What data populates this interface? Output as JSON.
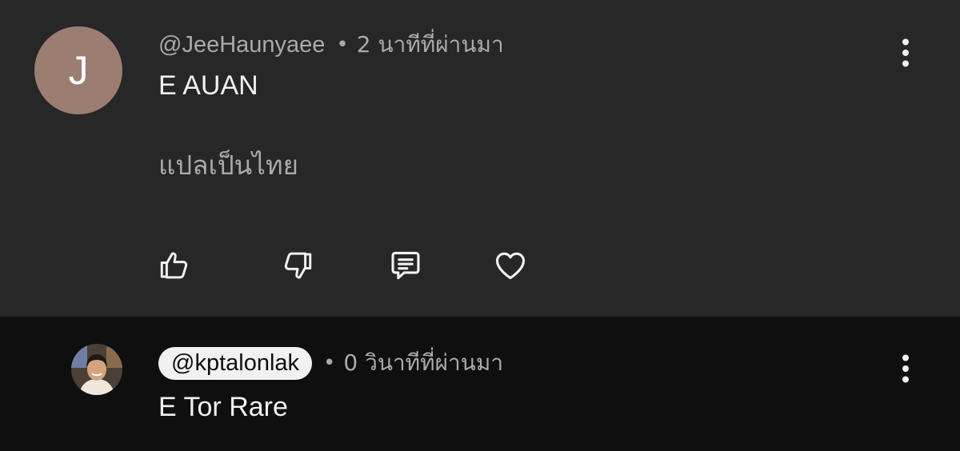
{
  "comment": {
    "avatar_letter": "J",
    "avatar_color": "#9c7d72",
    "author": "@JeeHaunyaee",
    "separator": "•",
    "time": "2 นาทีที่ผ่านมา",
    "text": "E AUAN",
    "translate_label": "แปลเป็นไทย",
    "actions": {
      "like_icon": "thumbs-up-icon",
      "dislike_icon": "thumbs-down-icon",
      "reply_icon": "comment-icon",
      "heart_icon": "heart-icon"
    },
    "menu_icon": "more-vert-icon"
  },
  "reply": {
    "author": "@kptalonlak",
    "separator": "•",
    "time": "0 วินาทีที่ผ่านมา",
    "text": "E Tor Rare",
    "menu_icon": "more-vert-icon"
  },
  "colors": {
    "comment_bg": "#272727",
    "reply_bg": "#0f0f0f",
    "secondary_text": "#aaaaaa",
    "primary_text": "#f1f1f1"
  }
}
